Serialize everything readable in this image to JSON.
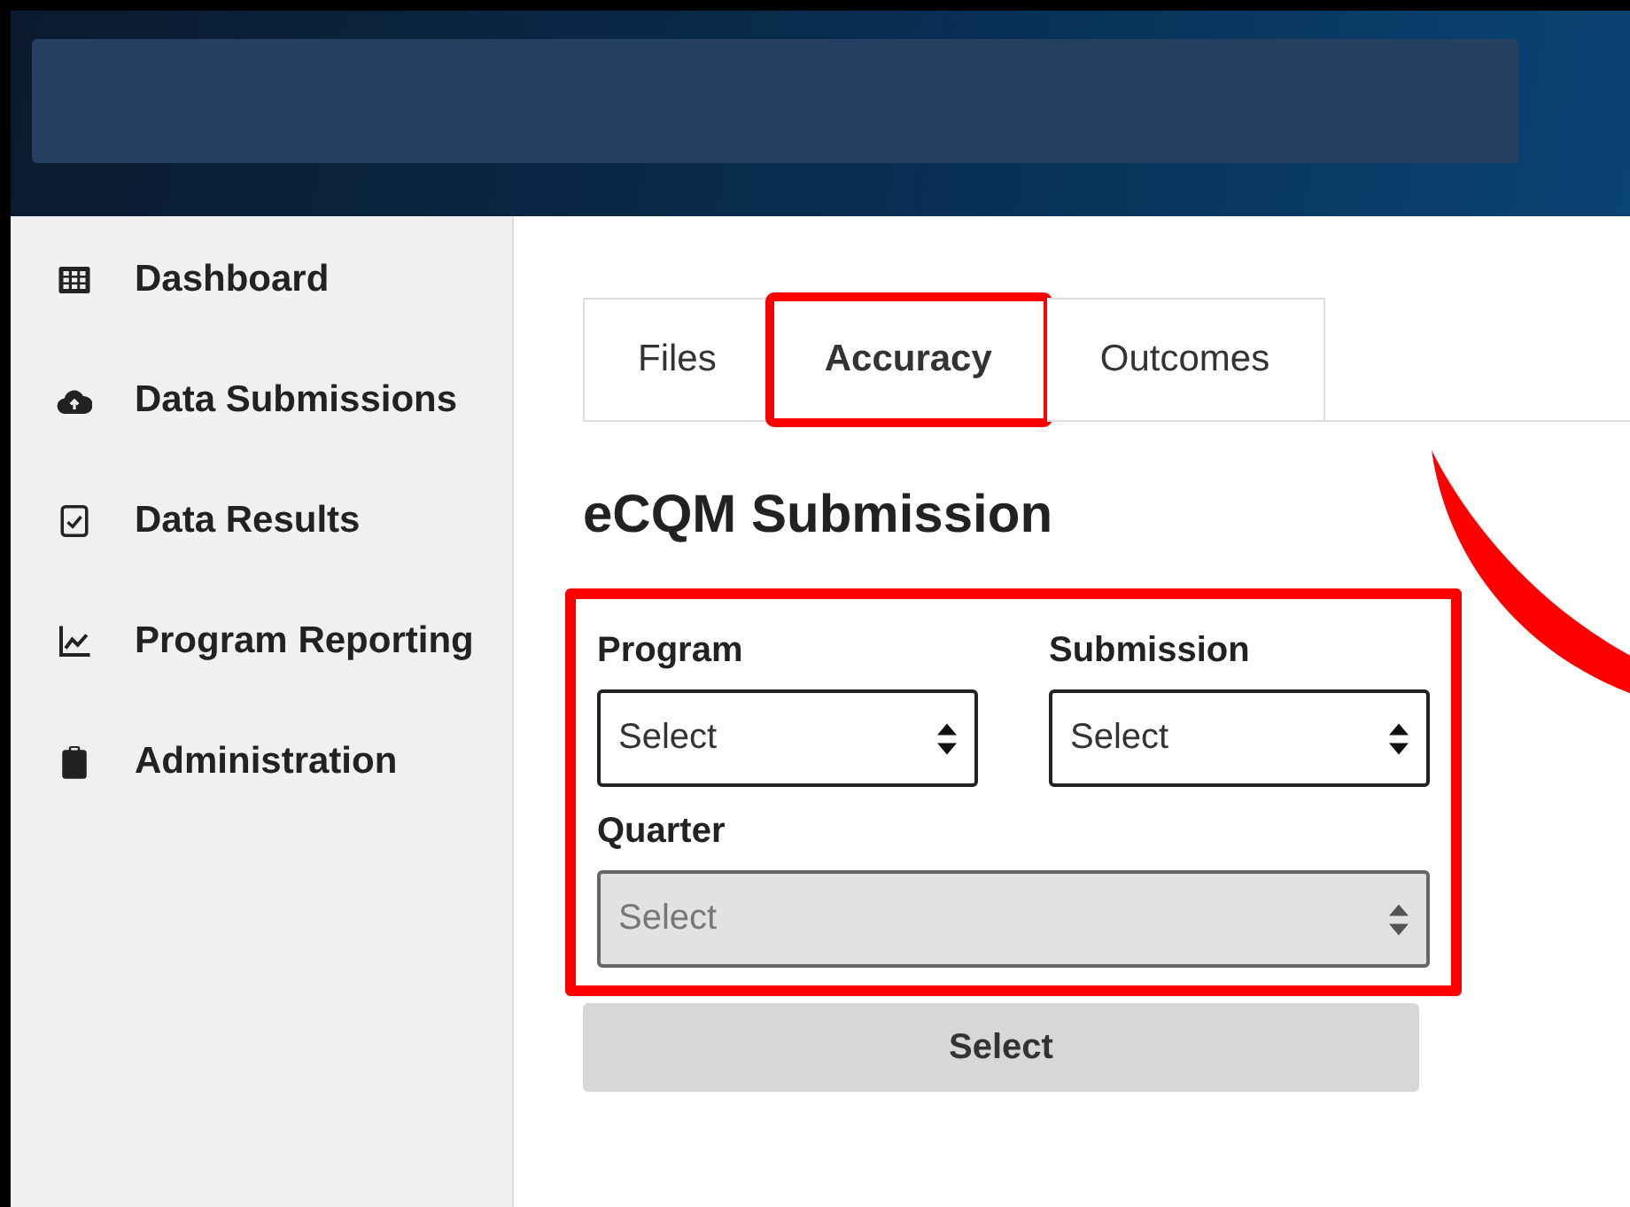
{
  "sidebar": {
    "items": [
      {
        "label": "Dashboard",
        "kind": "grid"
      },
      {
        "label": "Data Submissions",
        "kind": "cloud"
      },
      {
        "label": "Data Results",
        "kind": "check"
      },
      {
        "label": "Program Reporting",
        "kind": "chart"
      },
      {
        "label": "Administration",
        "kind": "clipboard"
      }
    ]
  },
  "tabs": [
    {
      "label": "Files",
      "selected": false,
      "highlighted": false
    },
    {
      "label": "Accuracy",
      "selected": true,
      "highlighted": true
    },
    {
      "label": "Outcomes",
      "selected": false,
      "highlighted": false
    }
  ],
  "heading": "eCQM Submission",
  "form": {
    "highlighted": true,
    "fields": [
      {
        "label": "Program",
        "value": "Select",
        "disabled": false
      },
      {
        "label": "Submission",
        "value": "Select",
        "disabled": false
      },
      {
        "label": "Quarter",
        "value": "Select",
        "disabled": true
      }
    ]
  },
  "submit_button": {
    "label": "Select",
    "disabled": true
  }
}
